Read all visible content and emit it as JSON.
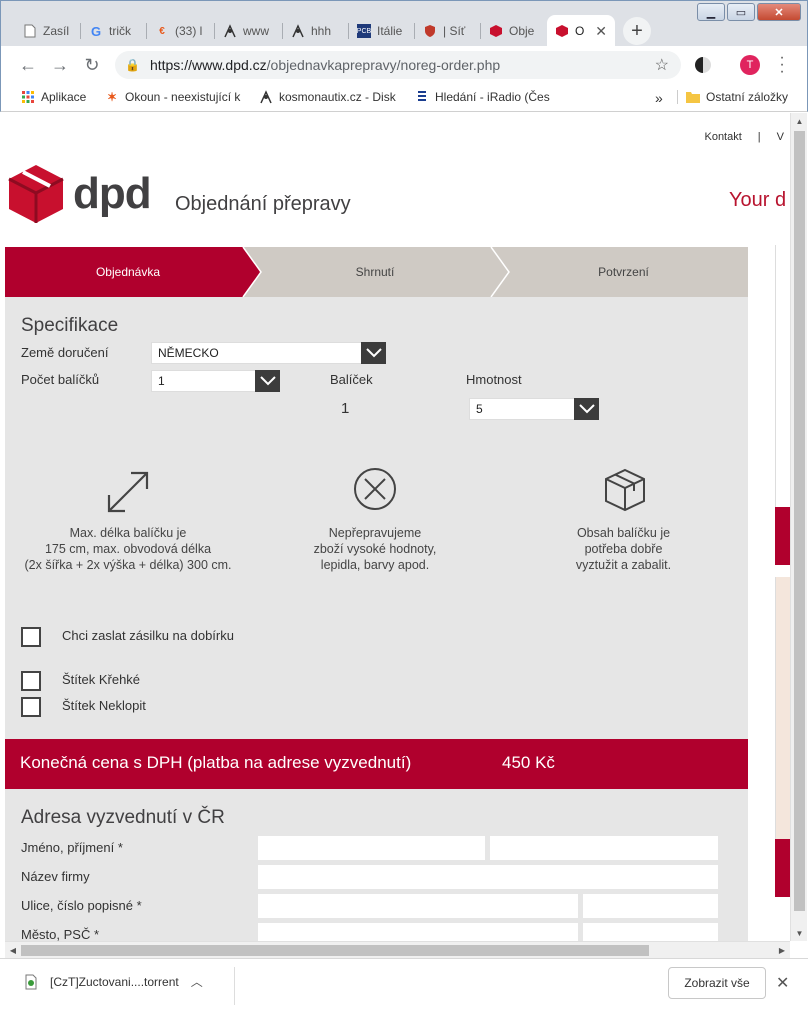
{
  "browser": {
    "tabs": [
      {
        "title": "Zasíl",
        "icon": "page-icon"
      },
      {
        "title": "tričk",
        "icon": "google-icon"
      },
      {
        "title": "(33) l",
        "icon": "okoun-icon"
      },
      {
        "title": "www",
        "icon": "kosmonautix-icon"
      },
      {
        "title": "hhh",
        "icon": "kosmonautix-icon"
      },
      {
        "title": "Itálie",
        "icon": "pcb-icon"
      },
      {
        "title": "| Síť",
        "icon": "shield-icon"
      },
      {
        "title": "Obje",
        "icon": "dpd-icon"
      },
      {
        "title": "O",
        "icon": "dpd-icon",
        "active": true
      }
    ],
    "url_host": "https://www.dpd.cz",
    "url_path": "/objednavkaprepravy/noreg-order.php",
    "profile_initial": "T",
    "bookmarks": [
      {
        "label": "Aplikace",
        "icon": "apps-grid-icon"
      },
      {
        "label": "Okoun - neexistující k",
        "icon": "okoun-icon"
      },
      {
        "label": "kosmonautix.cz - Disk",
        "icon": "kosmonautix-icon"
      },
      {
        "label": "Hledání - iRadio (Čes",
        "icon": "iradio-icon"
      }
    ],
    "bookmarks_overflow": "»",
    "other_bookmarks": "Ostatní záložky"
  },
  "header": {
    "top_links": [
      "Kontakt",
      "|",
      "V"
    ],
    "logo_text": "dpd",
    "title": "Objednání přepravy",
    "slogan": "Your d"
  },
  "steps": [
    "Objednávka",
    "Shrnutí",
    "Potvrzení"
  ],
  "spec": {
    "title": "Specifikace",
    "country_label": "Země doručení",
    "country_value": "NĚMECKO",
    "parcels_label": "Počet balíčků",
    "parcels_value": "1",
    "parcel_col_label": "Balíček",
    "parcel_number": "1",
    "weight_label": "Hmotnost",
    "weight_value": "5"
  },
  "info": [
    {
      "icon": "resize-arrows-icon",
      "text": [
        "Max. délka balíčku je",
        "175 cm, max. obvodová délka",
        "(2x šířka + 2x výška + délka) 300 cm."
      ]
    },
    {
      "icon": "prohibited-x-icon",
      "text": [
        "Nepřepravujeme",
        "zboží vysoké hodnoty,",
        "lepidla, barvy apod."
      ]
    },
    {
      "icon": "package-box-icon",
      "text": [
        "Obsah balíčku je",
        "potřeba dobře",
        "vyztužit a zabalit."
      ]
    }
  ],
  "options": {
    "cod_label": "Chci zaslat zásilku na dobírku",
    "fragile_label": "Štítek Křehké",
    "noflip_label": "Štítek Neklopit"
  },
  "price": {
    "label": "Konečná cena s DPH (platba na adrese vyzvednutí)",
    "value": "450 Kč"
  },
  "pickup": {
    "title": "Adresa vyzvednutí v ČR",
    "name_label": "Jméno, příjmení *",
    "company_label": "Název firmy",
    "street_label": "Ulice, číslo popisné *",
    "city_label": "Město, PSČ *"
  },
  "downloads": {
    "file": "[CzT]Zuctovani....torrent",
    "show_all": "Zobrazit vše"
  },
  "colors": {
    "brand_red": "#b0002d",
    "step_gray": "#cfcac4",
    "panel_gray": "#e6e6e6"
  }
}
